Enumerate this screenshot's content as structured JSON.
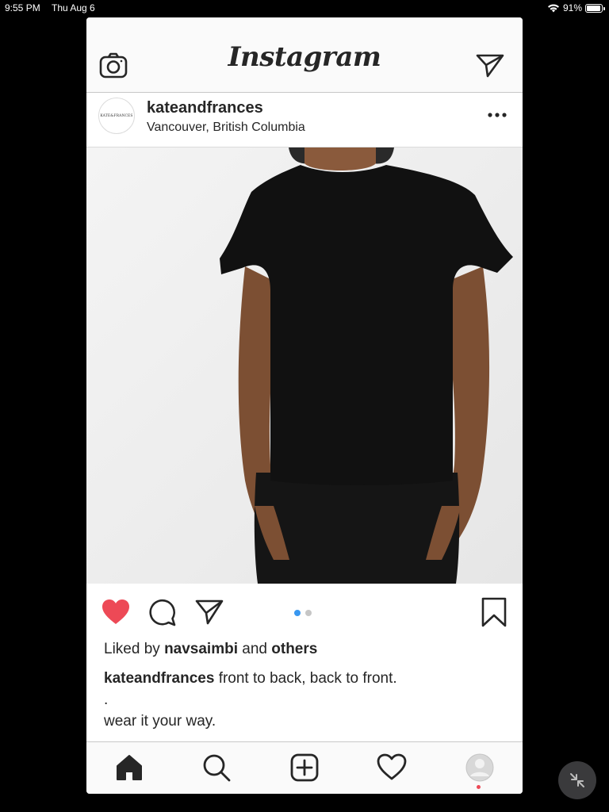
{
  "status_bar": {
    "time": "9:55 PM",
    "date": "Thu Aug 6",
    "battery": "91%",
    "icons": [
      "wifi-icon",
      "battery-icon"
    ]
  },
  "header": {
    "logo": "Instagram",
    "left_icon": "camera-icon",
    "right_icon": "direct-message-icon"
  },
  "post": {
    "avatar_text": "KATE&FRANCES",
    "username": "kateandfrances",
    "location": "Vancouver, British Columbia",
    "more_icon": "more-options-icon",
    "image_description_icon": "photo",
    "carousel": {
      "current": 1,
      "total": 2
    },
    "liked": true,
    "likes": {
      "prefix": "Liked by",
      "user": "navsaimbi",
      "joiner": "and",
      "others": "others"
    },
    "caption": {
      "username": "kateandfrances",
      "lines": [
        "front to back, back to front.",
        ".",
        "wear it your way."
      ]
    }
  },
  "colors": {
    "like_red": "#ed4956",
    "carousel_active": "#3897f0",
    "text": "#262626"
  },
  "tab_bar": {
    "items": [
      "home-icon",
      "search-icon",
      "new-post-icon",
      "activity-icon",
      "profile-icon"
    ]
  }
}
